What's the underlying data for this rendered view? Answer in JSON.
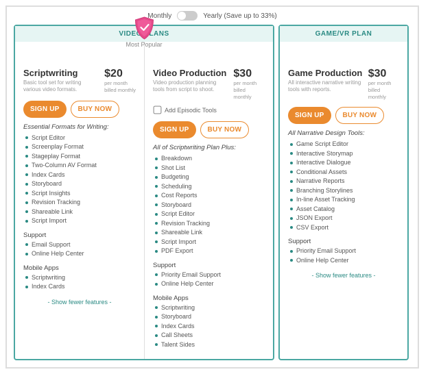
{
  "toggle": {
    "monthly": "Monthly",
    "yearly": "Yearly (Save up to 33%)"
  },
  "groups": {
    "video": "VIDEO PLANS",
    "game": "GAME/VR PLAN"
  },
  "badge": {
    "label": "Most Popular"
  },
  "buttons": {
    "signup": "SIGN UP",
    "buynow": "BUY NOW"
  },
  "fewer": "- Show fewer features -",
  "plans": {
    "scriptwriting": {
      "title": "Scriptwriting",
      "sub": "Basic tool set for writing various video formats.",
      "price": "$20",
      "price_sub1": "per month",
      "price_sub2": "billed monthly",
      "section": "Essential Formats for Writing:",
      "features": {
        "0": "Script Editor",
        "1": "Screenplay Format",
        "2": "Stageplay Format",
        "3": "Two-Column AV Format",
        "4": "Index Cards",
        "5": "Storyboard",
        "6": "Script Insights",
        "7": "Revision Tracking",
        "8": "Shareable Link",
        "9": "Script Import"
      },
      "support_h": "Support",
      "support": {
        "0": "Email Support",
        "1": "Online Help Center"
      },
      "mobile_h": "Mobile Apps",
      "mobile": {
        "0": "Scriptwriting",
        "1": "Index Cards"
      }
    },
    "videoproduction": {
      "title": "Video Production",
      "sub": "Video production planning tools from script to shoot.",
      "price": "$30",
      "price_sub1": "per month",
      "price_sub2": "billed monthly",
      "addon": "Add Episodic Tools",
      "section": "All of Scriptwriting Plan Plus:",
      "features": {
        "0": "Breakdown",
        "1": "Shot List",
        "2": "Budgeting",
        "3": "Scheduling",
        "4": "Cost Reports",
        "5": "Storyboard",
        "6": "Script Editor",
        "7": "Revision Tracking",
        "8": "Shareable Link",
        "9": "Script Import",
        "10": "PDF Export"
      },
      "support_h": "Support",
      "support": {
        "0": "Priority Email Support",
        "1": "Online Help Center"
      },
      "mobile_h": "Mobile Apps",
      "mobile": {
        "0": "Scriptwriting",
        "1": "Storyboard",
        "2": "Index Cards",
        "3": "Call Sheets",
        "4": "Talent Sides"
      }
    },
    "gameproduction": {
      "title": "Game Production",
      "sub": "All interactive narrative writing tools with reports.",
      "price": "$30",
      "price_sub1": "per month",
      "price_sub2": "billed monthly",
      "section": "All Narrative Design Tools:",
      "features": {
        "0": "Game Script Editor",
        "1": "Interactive Storymap",
        "2": "Interactive Dialogue",
        "3": "Conditional Assets",
        "4": "Narrative Reports",
        "5": "Branching Storylines",
        "6": "In-line Asset Tracking",
        "7": "Asset Catalog",
        "8": "JSON Export",
        "9": "CSV Export"
      },
      "support_h": "Support",
      "support": {
        "0": "Priority Email Support",
        "1": "Online Help Center"
      }
    }
  }
}
